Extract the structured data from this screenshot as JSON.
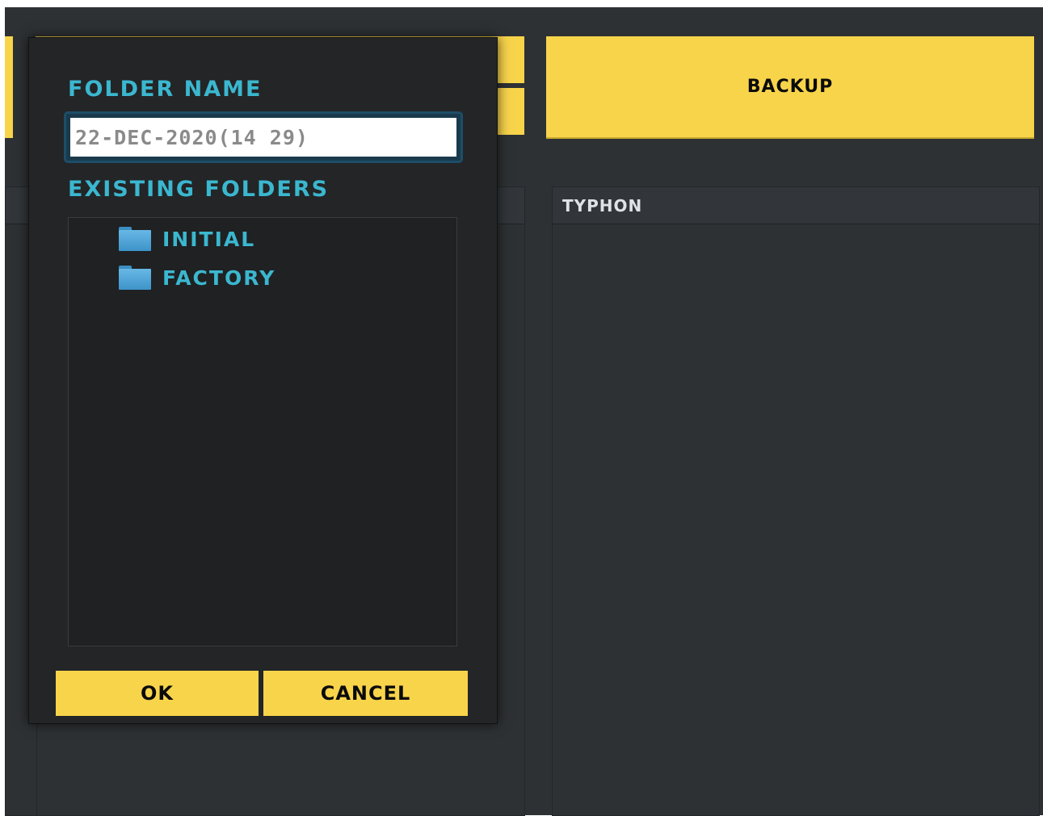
{
  "background": {
    "backup_label": "BACKUP",
    "right_panel_title": "TYPHON",
    "left_panel_title": ""
  },
  "dialog": {
    "folder_name_label": "FOLDER NAME",
    "folder_name_value": "22-DEC-2020(14 29)",
    "existing_folders_label": "EXISTING FOLDERS",
    "folders": [
      {
        "label": "INITIAL",
        "icon": "folder-icon"
      },
      {
        "label": "FACTORY",
        "icon": "folder-icon"
      }
    ],
    "ok_label": "OK",
    "cancel_label": "CANCEL"
  },
  "colors": {
    "accent_yellow": "#f8d44b",
    "accent_cyan": "#3bb7cf",
    "background_dark": "#2e3134",
    "dialog_background": "#232527"
  }
}
